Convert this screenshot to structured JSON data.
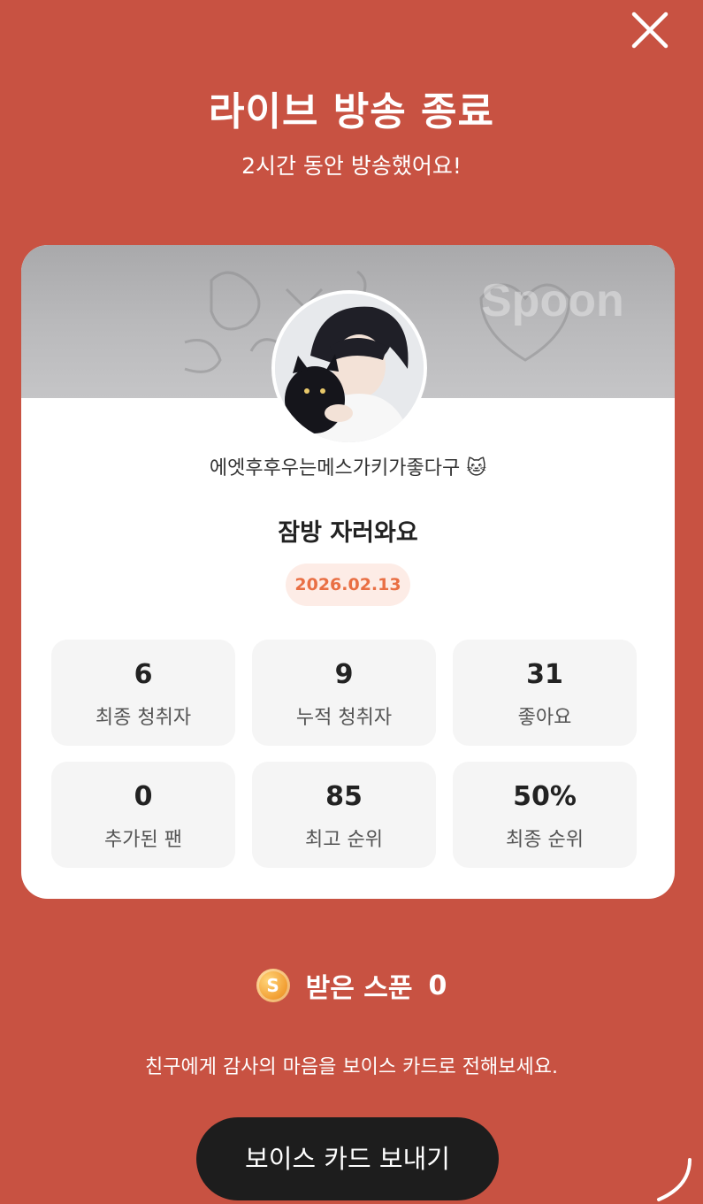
{
  "header": {
    "title": "라이브 방송 종료",
    "subtitle": "2시간 동안 방송했어요!"
  },
  "card": {
    "banner_watermark": "Spoon",
    "nickname": "에엣후후우는메스가키가좋다구 🐱",
    "live_title": "잠방 자러와요",
    "date": "2026.02.13",
    "stats": [
      {
        "value": "6",
        "label": "최종 청취자"
      },
      {
        "value": "9",
        "label": "누적 청취자"
      },
      {
        "value": "31",
        "label": "좋아요"
      },
      {
        "value": "0",
        "label": "추가된 팬"
      },
      {
        "value": "85",
        "label": "최고 순위"
      },
      {
        "value": "50%",
        "label": "최종 순위"
      }
    ]
  },
  "spoon": {
    "coin_letter": "S",
    "label": "받은 스푼",
    "count": "0"
  },
  "thanks_text": "친구에게 감사의 마음을 보이스 카드로 전해보세요.",
  "voice_card_button": "보이스 카드 보내기",
  "colors": {
    "background": "#c85242",
    "button": "#1d1d1d",
    "date_badge_bg": "#fdece6",
    "date_badge_text": "#e96f44"
  }
}
